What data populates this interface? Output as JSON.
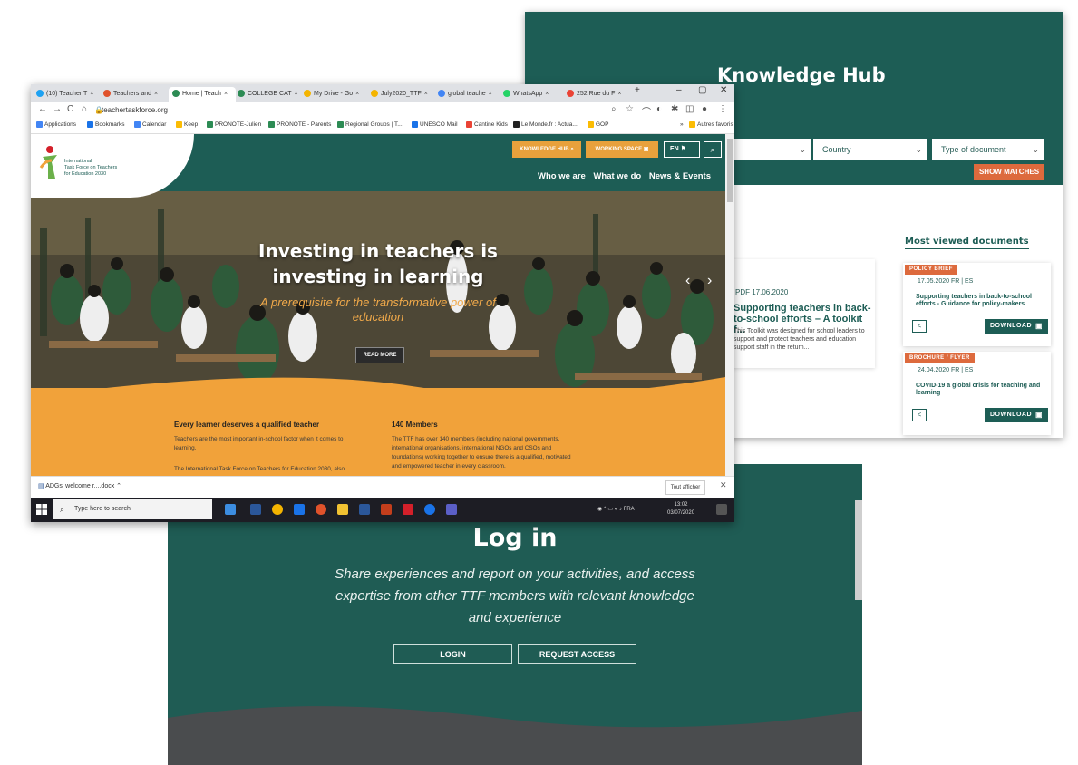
{
  "knowledge_hub": {
    "title": "Knowledge Hub",
    "filters": [
      {
        "label": ""
      },
      {
        "label": "Country"
      },
      {
        "label": "Type of document"
      }
    ],
    "show_matches": "SHOW MATCHES",
    "featured": {
      "meta": "PDF  17.06.2020",
      "title": "Supporting teachers in back-to-school efforts – A toolkit f...",
      "description": "This Toolkit was designed for school leaders to support and protect teachers and education support staff in the return..."
    },
    "most_viewed_heading": "Most viewed documents",
    "documents": [
      {
        "badge": "POLICY BRIEF",
        "meta": "17.05.2020  FR | ES",
        "title": "Supporting teachers in back-to-school efforts - Guidance for policy-makers",
        "download": "DOWNLOAD"
      },
      {
        "badge": "BROCHURE / FLYER",
        "meta": "24.04.2020  FR | ES",
        "title": "COVID-19 a global crisis for teaching and learning",
        "download": "DOWNLOAD"
      }
    ]
  },
  "login": {
    "title": "Log in",
    "subtitle": "Share experiences and report on your activities, and access expertise from other TTF members with relevant knowledge and experience",
    "login_button": "LOGIN",
    "request_button": "REQUEST ACCESS"
  },
  "browser": {
    "tabs": [
      {
        "label": "(10) Teacher T",
        "color": "#1da1f2"
      },
      {
        "label": "Teachers and",
        "color": "#e0522b"
      },
      {
        "label": "Home | Teach",
        "color": "#2c8b54"
      },
      {
        "label": "COLLEGE CAT",
        "color": "#2c8b54"
      },
      {
        "label": "My Drive - Go",
        "color": "#f4b400"
      },
      {
        "label": "July2020_TTF",
        "color": "#f4b400"
      },
      {
        "label": "global teache",
        "color": "#4285f4"
      },
      {
        "label": "WhatsApp",
        "color": "#25d366"
      },
      {
        "label": "252 Rue du F",
        "color": "#ea4335"
      }
    ],
    "url": "teachertaskforce.org",
    "bookmarks": [
      {
        "label": "Applications",
        "color": "#4285f4"
      },
      {
        "label": "Bookmarks",
        "color": "#1a73e8"
      },
      {
        "label": "Calendar",
        "color": "#4285f4"
      },
      {
        "label": "Keep",
        "color": "#fbbc04"
      },
      {
        "label": "PRONOTE-Julien",
        "color": "#2c8b54"
      },
      {
        "label": "PRONOTE - Parents",
        "color": "#2c8b54"
      },
      {
        "label": "Regional Groups | T...",
        "color": "#2c8b54"
      },
      {
        "label": "UNESCO Mail",
        "color": "#1a73e8"
      },
      {
        "label": "Cantine Kids",
        "color": "#ea4335"
      },
      {
        "label": "Le Monde.fr : Actua...",
        "color": "#222222"
      },
      {
        "label": "GOP",
        "color": "#fbbc04"
      }
    ],
    "bookmarks_more": "»",
    "bookmarks_other": "Autres favoris",
    "download_item": "ADGs' welcome r....docx",
    "download_all": "Tout afficher",
    "taskbar_search": "Type here to search",
    "tray": "FRA",
    "time": "13:02",
    "date": "03/07/2020"
  },
  "site": {
    "logo_text": [
      "International",
      "Task Force on Teachers",
      "for Education 2030"
    ],
    "knowledge_hub_button": "KNOWLEDGE HUB",
    "working_space_button": "WORKING SPACE",
    "lang_button": "EN",
    "nav": [
      "Who we are",
      "What we do",
      "News & Events"
    ],
    "hero_title": "Investing in teachers is investing in learning",
    "hero_subtitle": "A prerequisite for the transformative power of education",
    "read_more": "READ MORE",
    "col1_heading": "Every learner deserves a qualified teacher",
    "col1_p1": "Teachers are the most important in-school factor when it comes to learning.",
    "col1_p2": "The International Task Force on Teachers for Education 2030, also",
    "col2_heading": "140 Members",
    "col2_p": "The TTF has over 140 members (including national governments, international organisations, international NGOs and CSOs and foundations) working together to ensure there is a qualified, motivated and empowered teacher in every classroom."
  }
}
